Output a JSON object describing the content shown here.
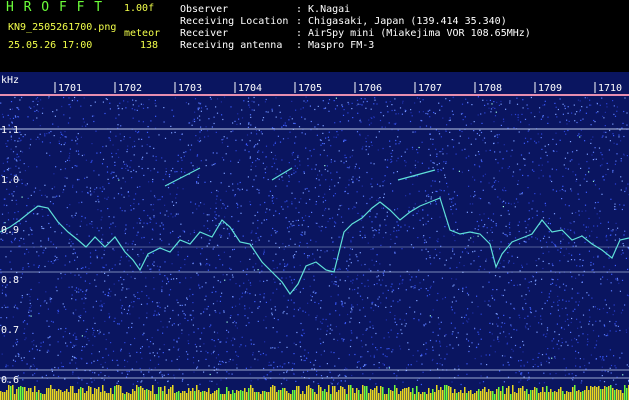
{
  "app": {
    "name": "H R O F F T",
    "version": "1.00f",
    "filename": "KN9_2505261700.png",
    "datetime": "25.05.26 17:00",
    "meteor_label": "meteor",
    "meteor_count": "138"
  },
  "info": {
    "rows": [
      {
        "label": "Observer",
        "value": ": K.Nagai"
      },
      {
        "label": "Receiving Location",
        "value": ": Chigasaki, Japan (139.414 35.340)"
      },
      {
        "label": "Receiver",
        "value": ": AirSpy mini (Miakejima VOR 108.65MHz)"
      },
      {
        "label": "Receiving antenna",
        "value": ": Maspro FM-3"
      }
    ]
  },
  "spectrogram": {
    "unit_label": "kHz",
    "y_ticks": [
      "1.1",
      "1.0",
      "0.9",
      "0.8",
      "0.7",
      "0.6"
    ],
    "time_labels": [
      "1701",
      "1702",
      "1703",
      "1704",
      "1705",
      "1706",
      "1707",
      "1708",
      "1709",
      "1710"
    ],
    "background_color": "#0a1560",
    "noise_color": "#3b5cff",
    "trace_color": "#5fe0d8",
    "carrier_color": "#d8e8ff",
    "footer_strip_color": "#e8d820"
  }
}
